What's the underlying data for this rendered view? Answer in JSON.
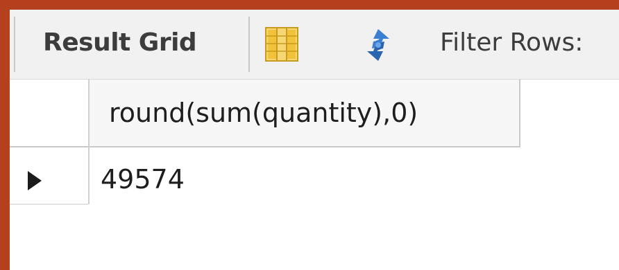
{
  "toolbar": {
    "result_grid_label": "Result Grid",
    "grid_icon": "grid-columns-icon",
    "refresh_icon": "refresh-arrows-icon",
    "filter_label": "Filter Rows:"
  },
  "grid": {
    "columns": [
      "round(sum(quantity),0)"
    ],
    "rows": [
      [
        "49574"
      ]
    ]
  },
  "colors": {
    "frame": "#b5401e",
    "toolbar_bg": "#f1f1f1",
    "grid_icon": "#f2c23a",
    "refresh_icon": "#3b7fd0"
  }
}
